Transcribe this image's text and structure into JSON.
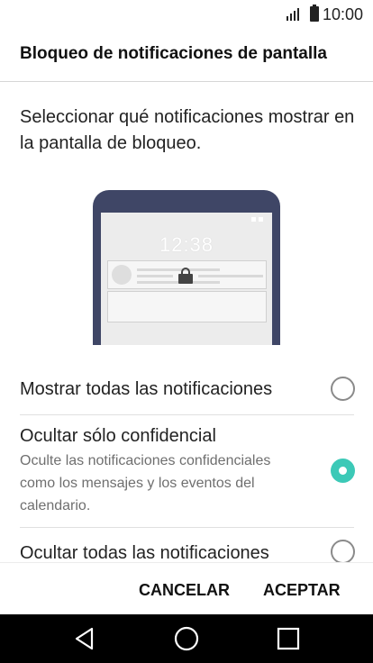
{
  "status_bar": {
    "time": "10:00",
    "icons": [
      "signal-icon",
      "battery-icon"
    ]
  },
  "header": {
    "title": "Bloqueo de notificaciones de pantalla"
  },
  "description": "Seleccionar qué notificaciones mostrar en la pantalla de bloqueo.",
  "preview": {
    "clock": "12:38"
  },
  "options": [
    {
      "label": "Mostrar todas las notificaciones",
      "sublabel": "",
      "selected": false
    },
    {
      "label": "Ocultar sólo confidencial",
      "sublabel": "Oculte las notificaciones confidenciales como los mensajes y los eventos del calendario.",
      "selected": true
    },
    {
      "label": "Ocultar todas las notificaciones",
      "sublabel": "",
      "selected": false
    }
  ],
  "actions": {
    "cancel": "CANCELAR",
    "accept": "ACEPTAR"
  },
  "navbar": {
    "icons": [
      "back-icon",
      "home-icon",
      "recents-icon"
    ]
  },
  "colors": {
    "accent": "#3cc9b7",
    "phone_frame": "#3f4666",
    "navbar": "#000000"
  }
}
